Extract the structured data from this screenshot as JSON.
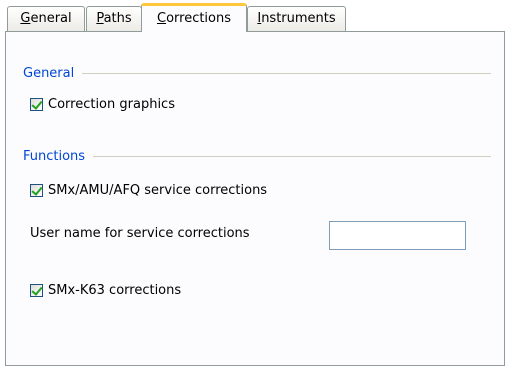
{
  "tabs": [
    {
      "label": "General",
      "mnemonic_first": "G",
      "rest": "eneral",
      "active": false
    },
    {
      "label": "Paths",
      "mnemonic_first": "P",
      "rest": "aths",
      "active": false
    },
    {
      "label": "Corrections",
      "mnemonic_first": "C",
      "rest": "orrections",
      "active": true
    },
    {
      "label": "Instruments",
      "mnemonic_first": "I",
      "rest": "nstruments",
      "active": false
    }
  ],
  "general_section": {
    "title": "General",
    "correction_graphics": {
      "label": "Correction graphics",
      "checked": true
    }
  },
  "functions_section": {
    "title": "Functions",
    "service_corrections": {
      "label": "SMx/AMU/AFQ service corrections",
      "checked": true
    },
    "user_name": {
      "label": "User name for service corrections",
      "value": ""
    },
    "smx_k63": {
      "label": "SMx-K63 corrections",
      "checked": true
    }
  },
  "colors": {
    "section_title": "#0046d5",
    "active_tab_accent": "#ffc83c",
    "check_mark": "#21a121"
  }
}
